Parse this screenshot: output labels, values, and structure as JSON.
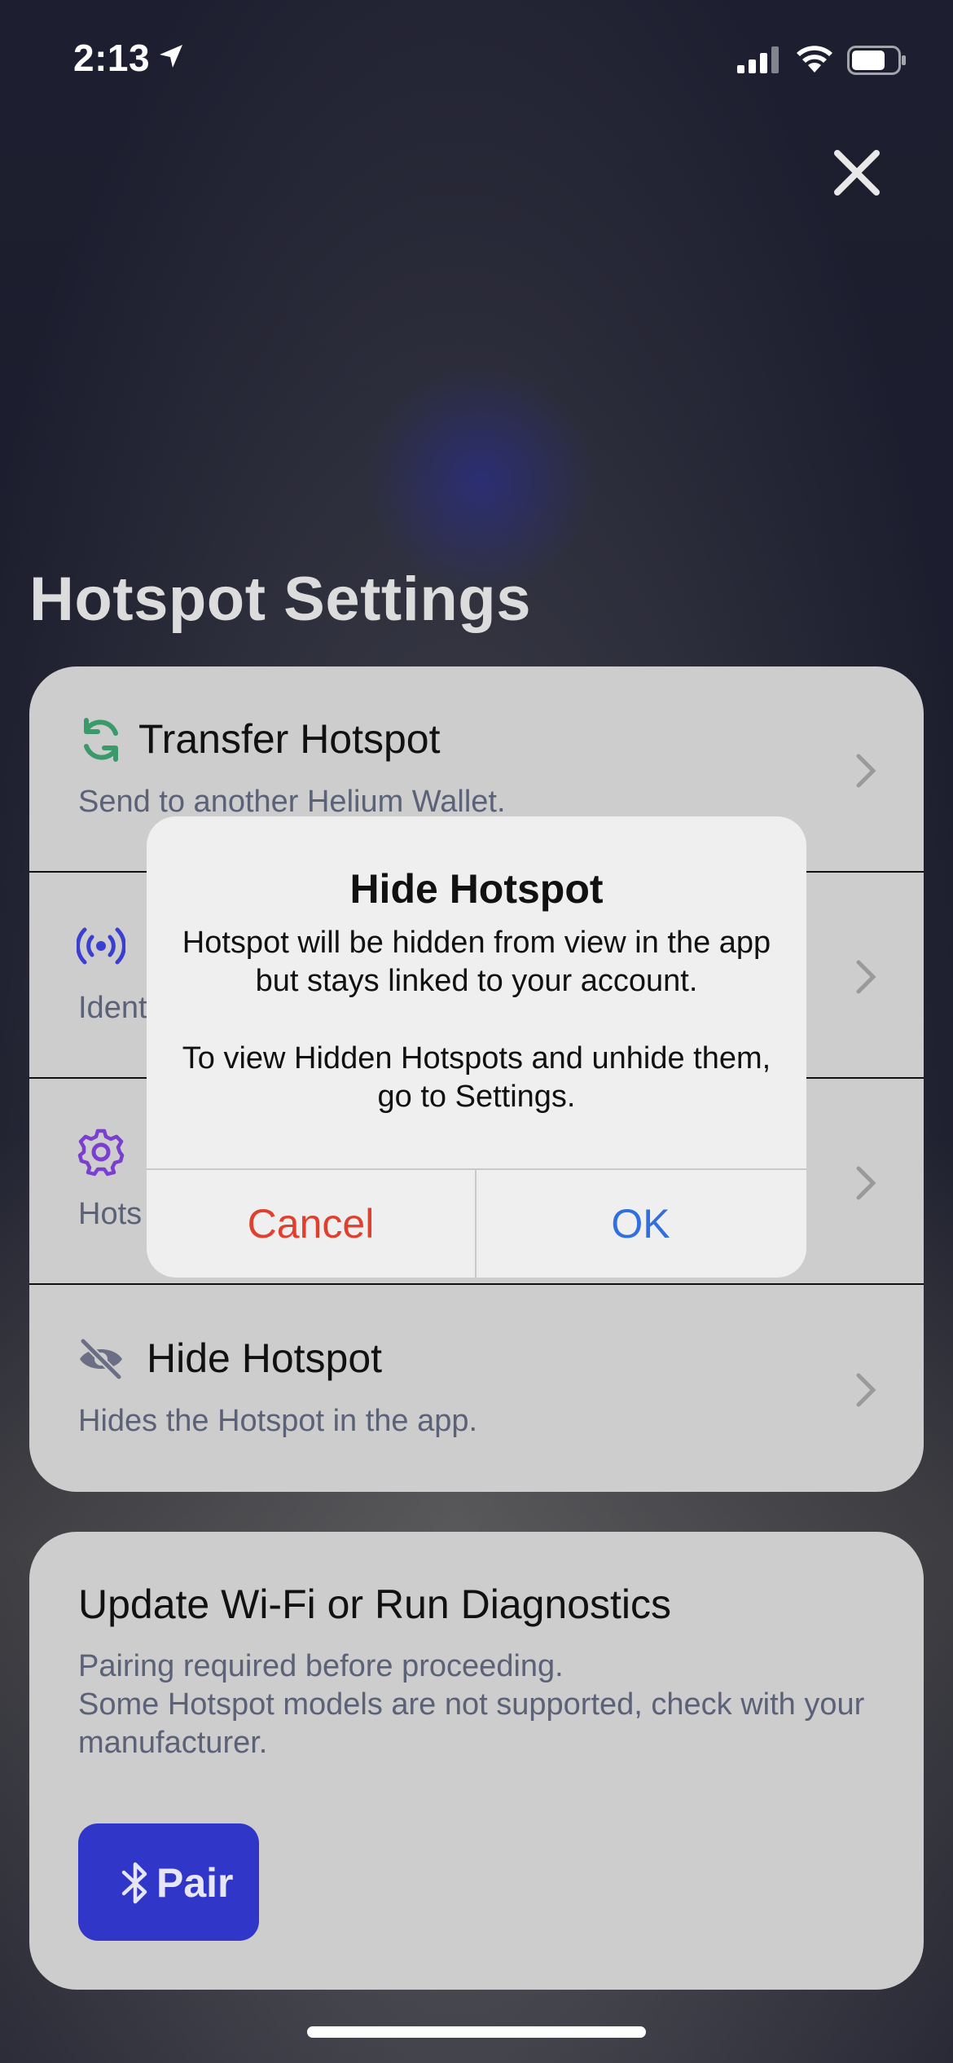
{
  "status_bar": {
    "time": "2:13",
    "icons": [
      "location-arrow-icon",
      "cellular-signal-icon",
      "wifi-icon",
      "battery-icon"
    ]
  },
  "header": {
    "title": "Hotspot Settings",
    "close_icon": "close-icon"
  },
  "settings": {
    "items": [
      {
        "icon": "transfer-icon",
        "title": "Transfer Hotspot",
        "subtitle": "Send to another Helium Wallet.",
        "color": "#3a9a6a"
      },
      {
        "icon": "broadcast-icon",
        "title": "",
        "subtitle": "Ident",
        "color": "#3b3fd0"
      },
      {
        "icon": "gear-icon",
        "title": "",
        "subtitle": "Hots",
        "color": "#7b3fd0"
      },
      {
        "icon": "eye-slash-icon",
        "title": "Hide Hotspot",
        "subtitle": "Hides the Hotspot in the app.",
        "color": "#6b6f85"
      }
    ]
  },
  "diagnostics": {
    "title": "Update Wi-Fi or Run Diagnostics",
    "subtitle_line1": "Pairing required before proceeding.",
    "subtitle_line2": "Some Hotspot models are not supported, check with your manufacturer.",
    "pair_label": "Pair",
    "pair_color": "#3036c8"
  },
  "alert": {
    "title": "Hide Hotspot",
    "message_1": "Hotspot will be hidden from view in the app but stays linked to your account.",
    "message_2": "To view Hidden Hotspots and unhide them, go to Settings.",
    "cancel_label": "Cancel",
    "ok_label": "OK",
    "cancel_color": "#e0402e",
    "ok_color": "#2f6fe0"
  }
}
